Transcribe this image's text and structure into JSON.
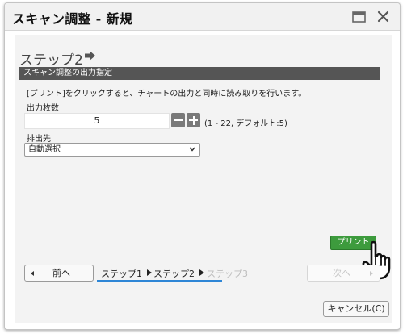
{
  "window": {
    "title": "スキャン調整 - 新規"
  },
  "step": {
    "heading": "ステップ2",
    "section_title": "スキャン調整の出力指定",
    "instruction": "[プリント]をクリックすると、チャートの出力と同時に読み取りを行います。"
  },
  "copies": {
    "label": "出力枚数",
    "value": "5",
    "range_hint": "(1 - 22, デフォルト:5)"
  },
  "destination": {
    "label": "排出先",
    "selected": "自動選択"
  },
  "buttons": {
    "print": "プリント",
    "prev": "前へ",
    "next": "次へ",
    "cancel": "キャンセル(C)"
  },
  "steps": [
    "ステップ1",
    "ステップ2",
    "ステップ3"
  ],
  "colors": {
    "section_bar": "#555555",
    "print_button": "#3d9b3d",
    "progress": "#2e86d6"
  },
  "icons": [
    "window-icon",
    "close-icon",
    "arrow-right-icon",
    "hand-pointer-icon",
    "chevron-down-icon"
  ]
}
